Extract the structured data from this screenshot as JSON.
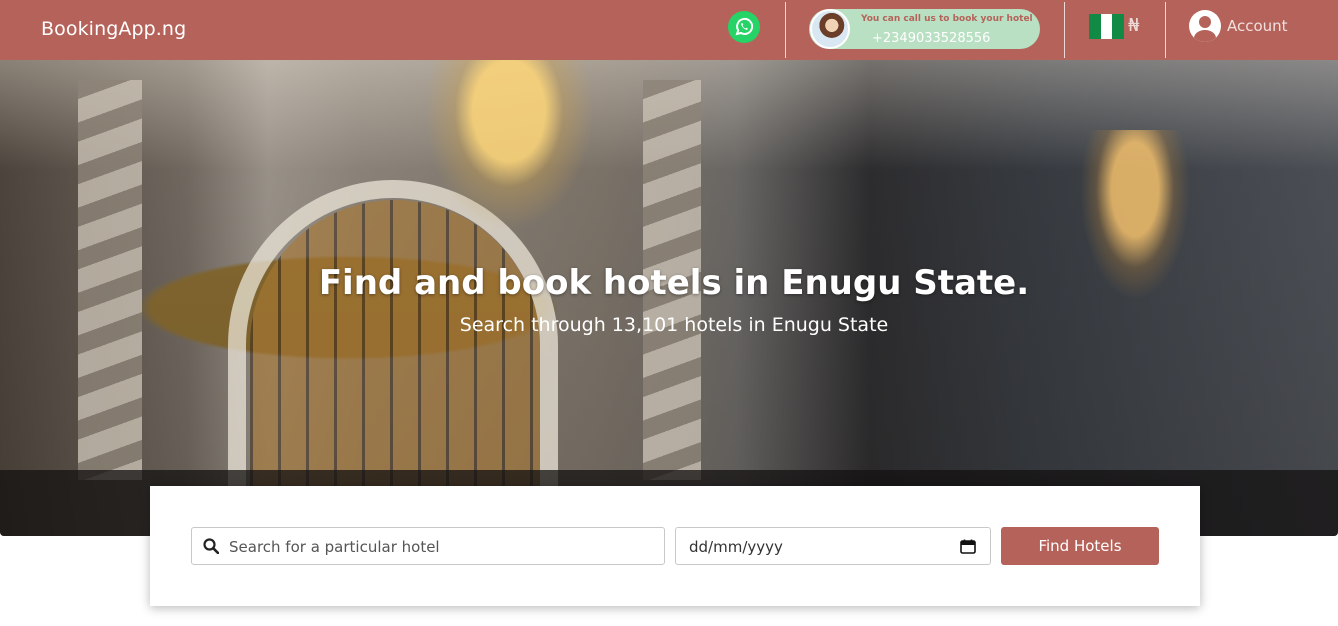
{
  "navbar": {
    "brand": "BookingApp.ng",
    "whatsapp_icon": "whatsapp-icon",
    "call": {
      "line1": "You can call us to book your hotel",
      "phone": "+2349033528556"
    },
    "currency_symbol": "₦",
    "country_flag": "nigeria-flag",
    "account_label": "Account",
    "account_icon": "user-circle-icon"
  },
  "hero": {
    "title": "Find and book hotels in Enugu State.",
    "subtitle": "Search through 13,101 hotels in Enugu State"
  },
  "search": {
    "placeholder": "Search for a particular hotel",
    "date_placeholder": "dd/mm/yyyy",
    "button_label": "Find Hotels",
    "search_icon": "search-icon",
    "calendar_icon": "calendar-icon"
  },
  "colors": {
    "brand": "#b5635a",
    "call_pill": "#b9e0c3",
    "whatsapp": "#25d366",
    "flag_green": "#118a46"
  }
}
